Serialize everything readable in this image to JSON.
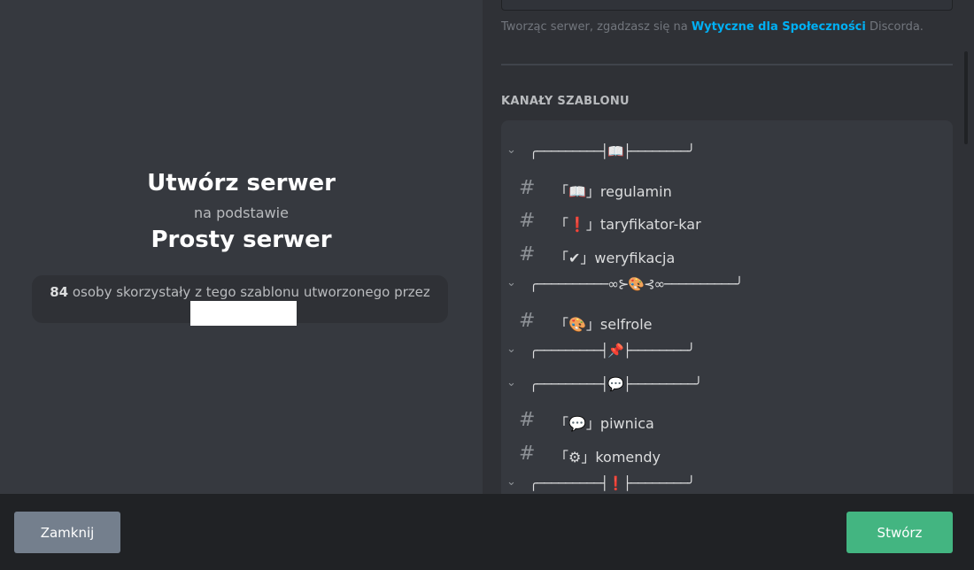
{
  "left": {
    "title": "Utwórz serwer",
    "subtitle": "na podstawie",
    "template_name": "Prosty serwer",
    "usage": {
      "count": "84",
      "text": " osoby skorzystały z tego szablonu utworzonego przez"
    }
  },
  "right": {
    "tos": {
      "prefix": "Tworząc serwer, zgadzasz się na ",
      "link": "Wytyczne dla Społeczności",
      "suffix": " Discorda."
    },
    "section_label": "KANAŁY SZABLONU",
    "rows": [
      {
        "type": "category",
        "name": "╭─────────┤📖├────────╯"
      },
      {
        "type": "channel",
        "name": "「📖」regulamin"
      },
      {
        "type": "channel",
        "name": "「❗」taryfikator-kar"
      },
      {
        "type": "channel",
        "name": "「✔」weryfikacja"
      },
      {
        "type": "category",
        "name": "╭──────────∞⊱🎨⊰∞──────────╯"
      },
      {
        "type": "channel",
        "name": "「🎨」selfrole"
      },
      {
        "type": "category",
        "name": "╭─────────┤📌├────────╯"
      },
      {
        "type": "category",
        "name": "╭─────────┤💬├─────────╯"
      },
      {
        "type": "channel",
        "name": "「💬」piwnica"
      },
      {
        "type": "channel",
        "name": "「⚙」komendy"
      },
      {
        "type": "category",
        "name": "╭─────────┤❗├────────╯"
      }
    ]
  },
  "footer": {
    "close_label": "Zamknij",
    "create_label": "Stwórz"
  },
  "icons": {
    "hash": "#",
    "chevron": "⌄"
  },
  "colors": {
    "accent_link": "#00b0f4",
    "create_button": "#43b581",
    "close_button": "#747f8d"
  }
}
